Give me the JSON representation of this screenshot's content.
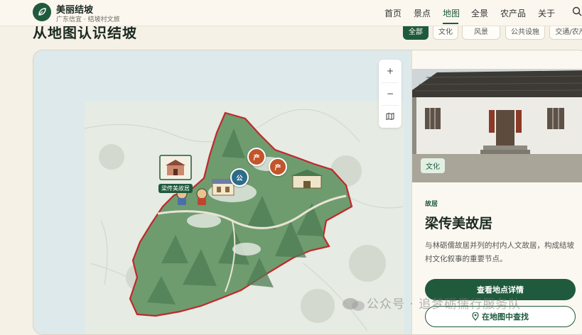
{
  "header": {
    "brand_title": "美丽结坡",
    "brand_subtitle": "广东信宜 · 结坡村文旅",
    "nav": [
      "首页",
      "景点",
      "地图",
      "全景",
      "农产品",
      "关于"
    ],
    "active_nav": "地图"
  },
  "section": {
    "title": "从地图认识结坡",
    "filters": [
      "全部",
      "文化",
      "风景",
      "公共设施",
      "交通/农产"
    ],
    "active_filter": "全部"
  },
  "map": {
    "zoom_in": "+",
    "zoom_out": "−",
    "markers": {
      "featured_label": "梁传美故居",
      "produce_1": "产",
      "produce_2": "产",
      "public": "公"
    }
  },
  "detail": {
    "tag": "文化",
    "category": "故居",
    "title": "梁传美故居",
    "description": "与林砺儒故居并列的村内人文故居，构成结坡村文化叙事的重要节点。",
    "primary_button": "查看地点详情",
    "secondary_button": "在地图中查找"
  },
  "watermark": "公众号 · 追梦砺儒行服务队",
  "colors": {
    "primary": "#1f5a3c",
    "marker_produce": "#c2552b",
    "marker_public": "#2e6b8a",
    "boundary": "#c0282b"
  }
}
